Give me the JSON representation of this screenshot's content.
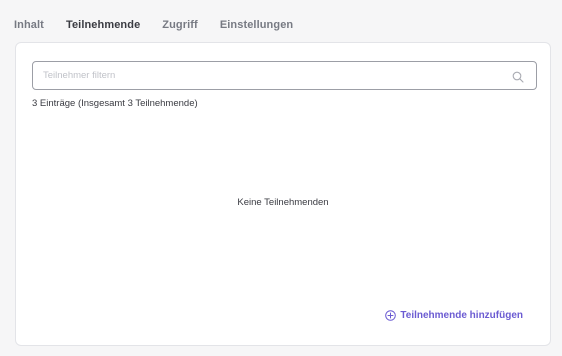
{
  "tabs": [
    {
      "label": "Inhalt",
      "active": false
    },
    {
      "label": "Teilnehmende",
      "active": true
    },
    {
      "label": "Zugriff",
      "active": false
    },
    {
      "label": "Einstellungen",
      "active": false
    }
  ],
  "search": {
    "placeholder": "Teilnehmer filtern",
    "value": "",
    "icon": "search-icon"
  },
  "summary": {
    "count_text": "3 Einträge (Insgesamt 3 Teilnehmende)"
  },
  "empty_state": {
    "text": "Keine Teilnehmenden"
  },
  "actions": {
    "add_label": "Teilnehmende hinzufügen",
    "add_icon": "plus-circle-icon"
  },
  "colors": {
    "accent": "#6b5bd2",
    "background": "#f6f6f7",
    "panel": "#ffffff"
  }
}
